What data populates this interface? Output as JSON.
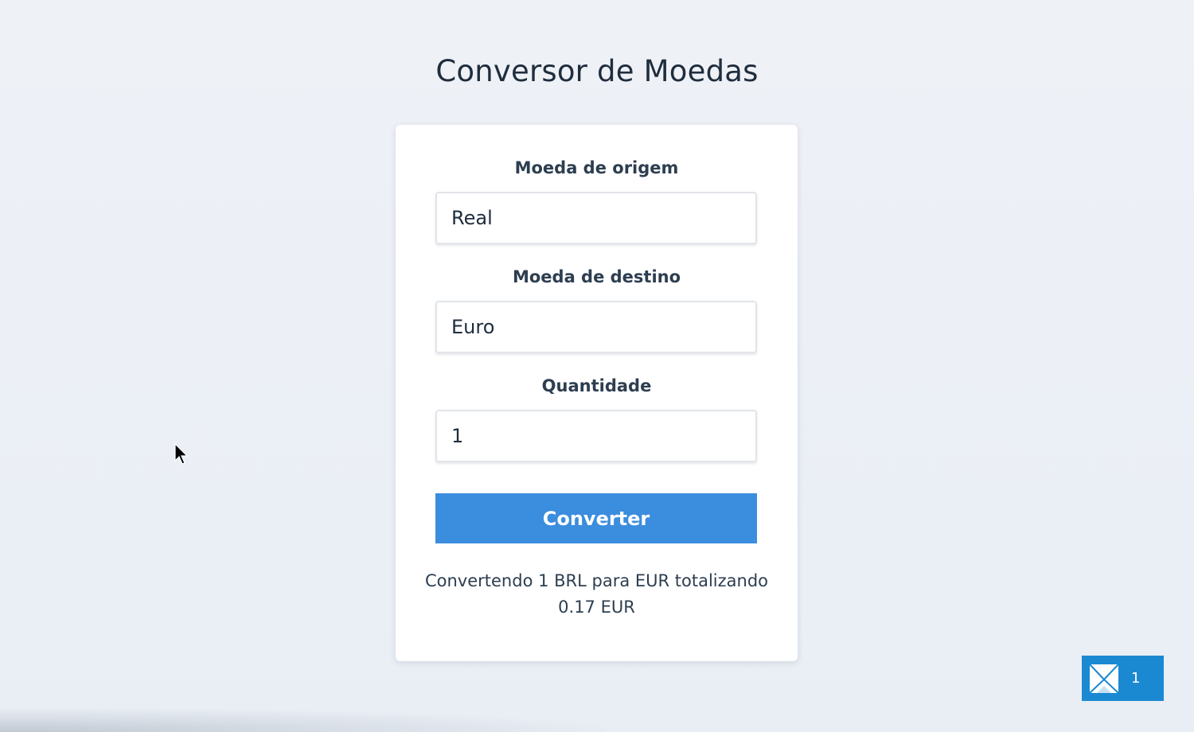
{
  "page": {
    "title": "Conversor de Moedas"
  },
  "form": {
    "source_label": "Moeda de origem",
    "source_value": "Real",
    "target_label": "Moeda de destino",
    "target_value": "Euro",
    "amount_label": "Quantidade",
    "amount_value": "1",
    "convert_label": "Converter"
  },
  "result": {
    "line1": "Convertendo 1 BRL para EUR totalizando",
    "line2": "0.17 EUR"
  },
  "badge": {
    "icon": "envelope-icon",
    "count": "1",
    "color": "#1b88d2"
  },
  "colors": {
    "accent": "#3b8ddd",
    "background": "#eef1f6",
    "text": "#1f2d3d"
  }
}
